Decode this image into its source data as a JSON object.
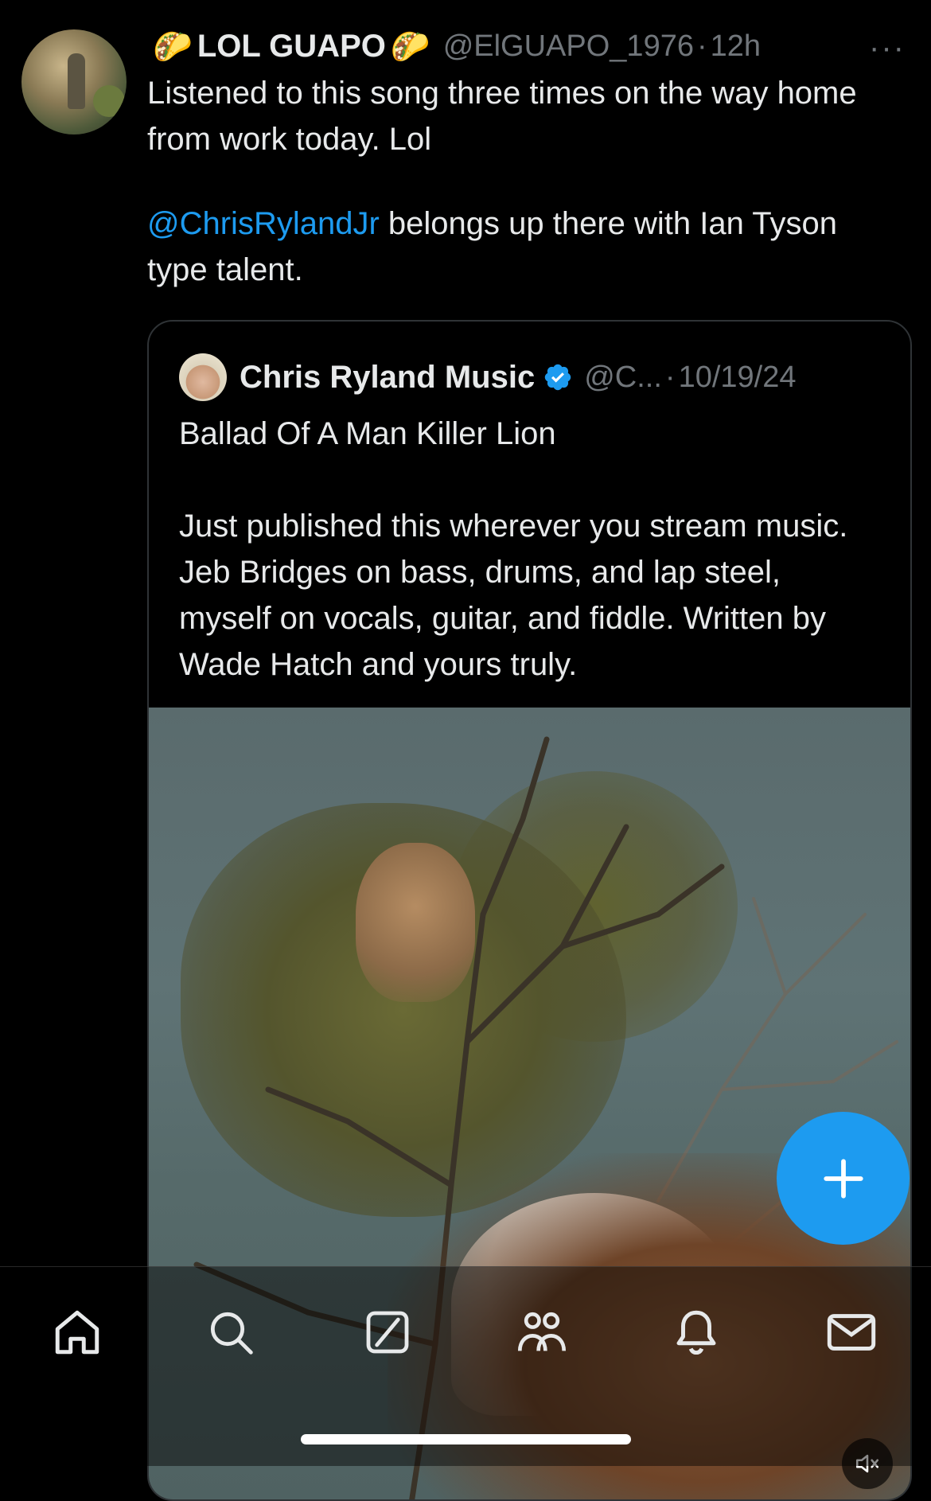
{
  "tweet": {
    "author_name": "LOL GUAPO",
    "name_emoji": "🌮",
    "handle": "@ElGUAPO_1976",
    "separator": "·",
    "time": "12h",
    "more": "···",
    "text_line1": "Listened to this song three times on the way home from work today. Lol",
    "mention": "@ChrisRylandJr",
    "text_line2": " belongs up there with Ian Tyson type talent."
  },
  "quote": {
    "author_name": "Chris Ryland Music",
    "handle": "@C...",
    "separator": "·",
    "date": "10/19/24",
    "title": "Ballad Of A Man Killer Lion",
    "body": "Just published this wherever you stream music. Jeb Bridges on bass, drums, and lap steel, myself on vocals, guitar, and fiddle. Written by Wade Hatch and yours truly."
  },
  "compose_fab": {
    "icon": "plus-icon"
  },
  "tabbar": {
    "items": [
      {
        "icon": "home-icon"
      },
      {
        "icon": "search-icon"
      },
      {
        "icon": "grok-icon"
      },
      {
        "icon": "communities-icon"
      },
      {
        "icon": "notifications-icon"
      },
      {
        "icon": "messages-icon"
      }
    ]
  },
  "colors": {
    "accent": "#1d9bf0",
    "background": "#000000",
    "muted": "#71767b",
    "text": "#e7e9ea"
  }
}
